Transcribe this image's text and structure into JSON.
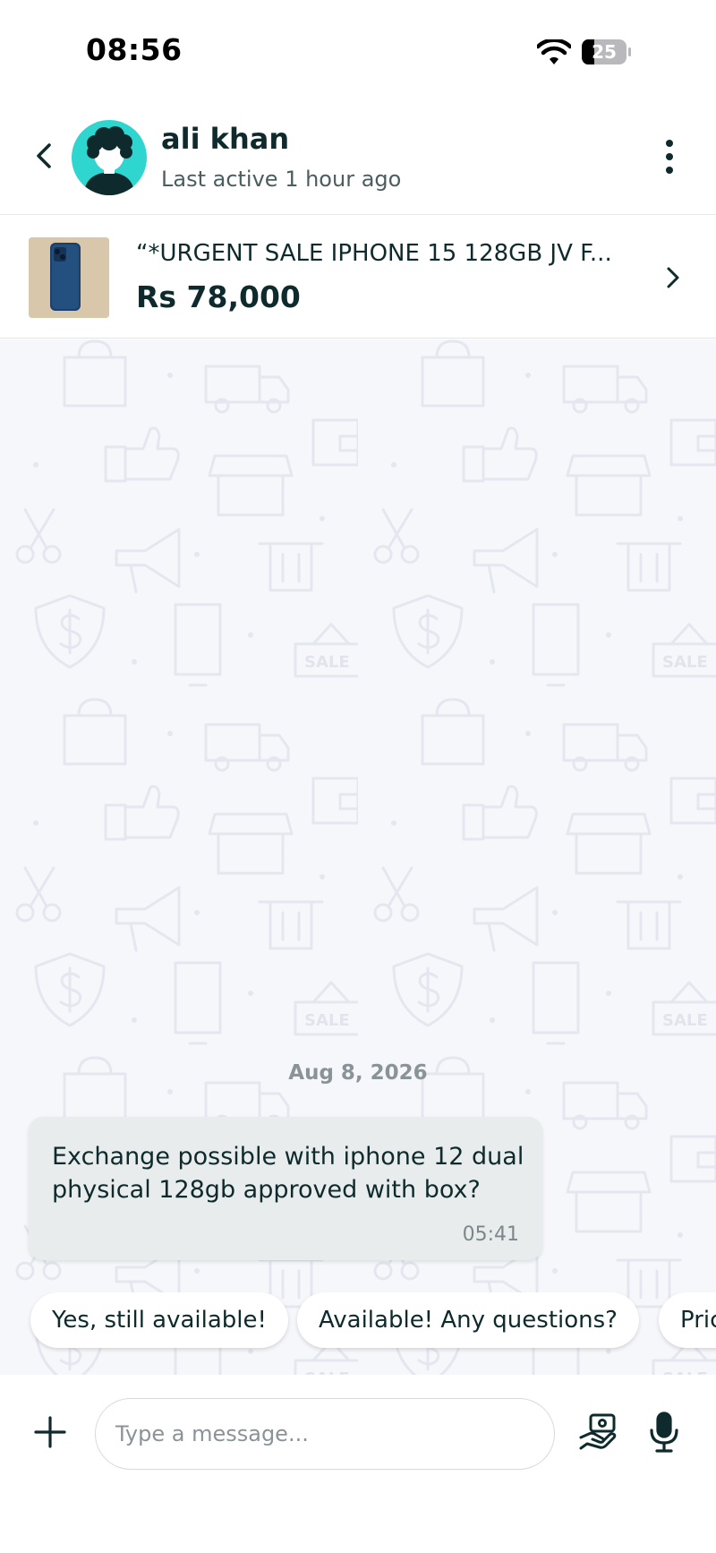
{
  "status_bar": {
    "time": "08:56",
    "battery": "25",
    "icons": [
      "wifi-icon",
      "battery-icon"
    ]
  },
  "header": {
    "contact_name": "ali khan",
    "last_active": "Last active 1 hour ago",
    "icons": [
      "back-arrow-icon",
      "avatar",
      "more-vertical-icon"
    ]
  },
  "listing": {
    "title": "“*URGENT SALE IPHONE 15 128GB JV F...",
    "price": "Rs 78,000",
    "icons": [
      "phone-thumbnail",
      "chevron-right-icon"
    ]
  },
  "chat": {
    "date": "Aug 8, 2026",
    "messages": [
      {
        "text": "Exchange possible with iphone 12 dual physical 128gb approved with box?",
        "time": "05:41"
      }
    ]
  },
  "quick_replies": [
    "Yes, still available!",
    "Available! Any questions?",
    "Pric"
  ],
  "input_bar": {
    "placeholder": "Type a message...",
    "icons": [
      "plus-icon",
      "offer-hand-icon",
      "microphone-icon"
    ]
  },
  "colors": {
    "accent_teal": "#2ed6cf",
    "text_dark": "#0f2a2c",
    "chat_background": "#f6f7fa",
    "bubble": "#e9ecec"
  }
}
